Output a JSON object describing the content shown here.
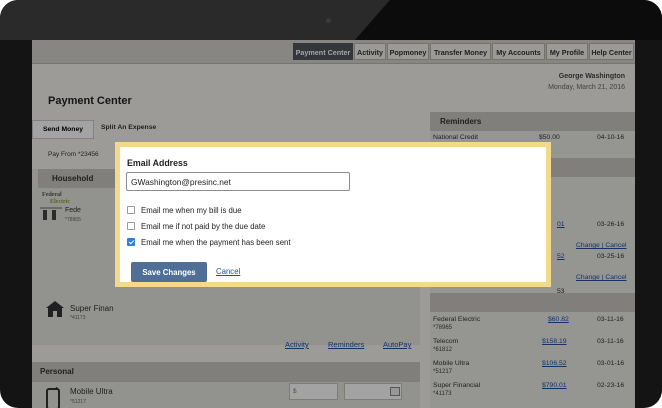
{
  "nav": {
    "items": [
      "Payment Center",
      "Activity",
      "Popmoney",
      "Transfer Money",
      "My Accounts",
      "My Profile",
      "Help Center"
    ],
    "active": "Payment Center"
  },
  "page": {
    "title": "Payment Center",
    "user_name": "George Washington",
    "date": "Monday, March 21, 2016"
  },
  "tabs": [
    "Send Money",
    "Split An Expense"
  ],
  "pay_from": "Pay From *23456",
  "household": {
    "heading": "Household",
    "logo_text_1": "Federal",
    "logo_text_2": "Electric",
    "payee_1": {
      "name": "Fede",
      "acct": "*78965"
    },
    "payee_2": {
      "name": "Super Finan",
      "acct": "*41173"
    }
  },
  "links": {
    "activity": "Activity",
    "reminders": "Reminders",
    "autopay": "AutoPay"
  },
  "personal": {
    "heading": "Personal",
    "payee": {
      "name": "Mobile Ultra",
      "acct": "*51217"
    },
    "amount_placeholder": "$"
  },
  "reminders": {
    "heading": "Reminders",
    "row": {
      "name": "National Credit",
      "amount": "$50.00",
      "date": "04-10-16"
    }
  },
  "scheduled_partial": {
    "amount_1": "01",
    "date_1": "03-26-16",
    "change_1": "Change | Cancel",
    "amount_2": "52",
    "date_2": "03-25-16",
    "change_2": "Change | Cancel",
    "amount_3": "53"
  },
  "recent": [
    {
      "name": "Federal Electric",
      "acct": "*78965",
      "amount": "$60.82",
      "date": "03-11-16"
    },
    {
      "name": "Telecom",
      "acct": "*61812",
      "amount": "$158.19",
      "date": "03-11-16"
    },
    {
      "name": "Mobile Ultra",
      "acct": "*51217",
      "amount": "$106.52",
      "date": "03-01-16"
    },
    {
      "name": "Super Financial",
      "acct": "*41173",
      "amount": "$790.01",
      "date": "02-23-16"
    }
  ],
  "modal": {
    "title": "Email Address",
    "email": "GWashington@presinc.net",
    "options": [
      {
        "label": "Email me when my bill is due",
        "checked": false
      },
      {
        "label": "Email me if not paid by the due date",
        "checked": false
      },
      {
        "label": "Email me when the payment has been sent",
        "checked": true
      }
    ],
    "save_label": "Save Changes",
    "cancel_label": "Cancel"
  },
  "colors": {
    "accent": "#4f6f97",
    "modal_border": "#f3d98a",
    "checkbox_on": "#2f7de1",
    "link": "#1e4fa0"
  }
}
